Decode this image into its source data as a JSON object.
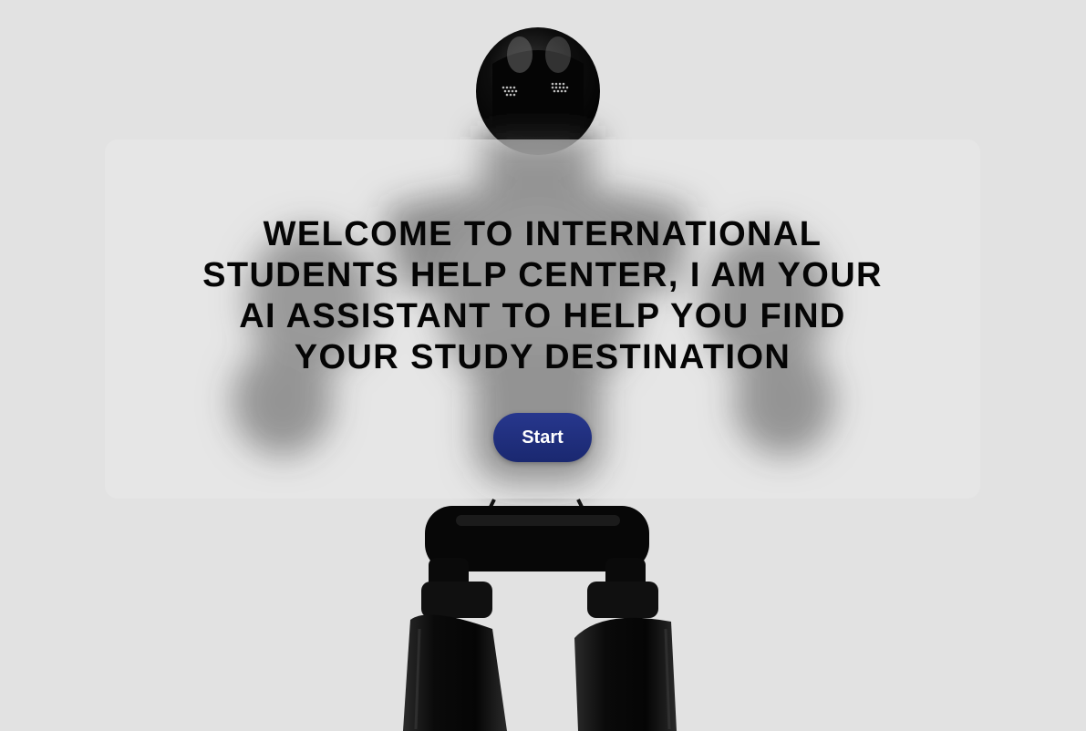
{
  "hero": {
    "headline_lines": [
      "WELCOME TO INTERNATIONAL",
      "STUDENTS HELP CENTER, I AM YOUR",
      "AI ASSISTANT TO HELP YOU FIND",
      "YOUR STUDY DESTINATION"
    ],
    "start_label": "Start"
  },
  "colors": {
    "background": "#e2e2e2",
    "button": "#1f2f7e",
    "headline": "#050505"
  },
  "icons": {
    "background_art": "robot-illustration"
  }
}
